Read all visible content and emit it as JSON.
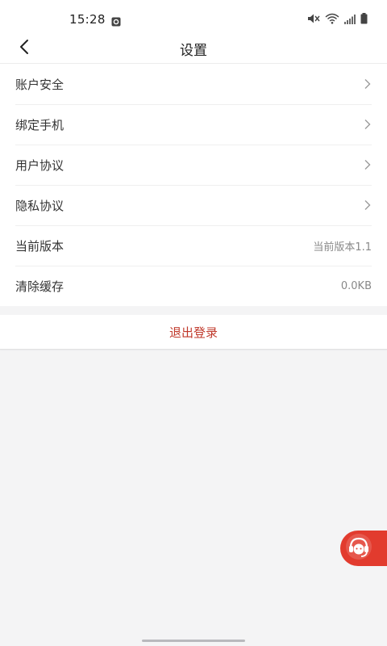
{
  "status_bar": {
    "time": "15:28",
    "icons": [
      "notification-icon",
      "mute-icon",
      "wifi-icon",
      "signal-icon",
      "battery-icon"
    ]
  },
  "header": {
    "title": "设置",
    "back_icon": "chevron-left-icon"
  },
  "settings": {
    "items": [
      {
        "label": "账户安全",
        "value": "",
        "has_arrow": true
      },
      {
        "label": "绑定手机",
        "value": "",
        "has_arrow": true
      },
      {
        "label": "用户协议",
        "value": "",
        "has_arrow": true
      },
      {
        "label": "隐私协议",
        "value": "",
        "has_arrow": true
      },
      {
        "label": "当前版本",
        "value": "当前版本1.1",
        "has_arrow": false
      },
      {
        "label": "清除缓存",
        "value": "0.0KB",
        "has_arrow": false
      }
    ]
  },
  "logout": {
    "label": "退出登录"
  },
  "floating": {
    "icon": "customer-service-icon"
  },
  "colors": {
    "accent": "#e23b2e",
    "logout_text": "#c0392b",
    "background": "#f4f4f5"
  }
}
